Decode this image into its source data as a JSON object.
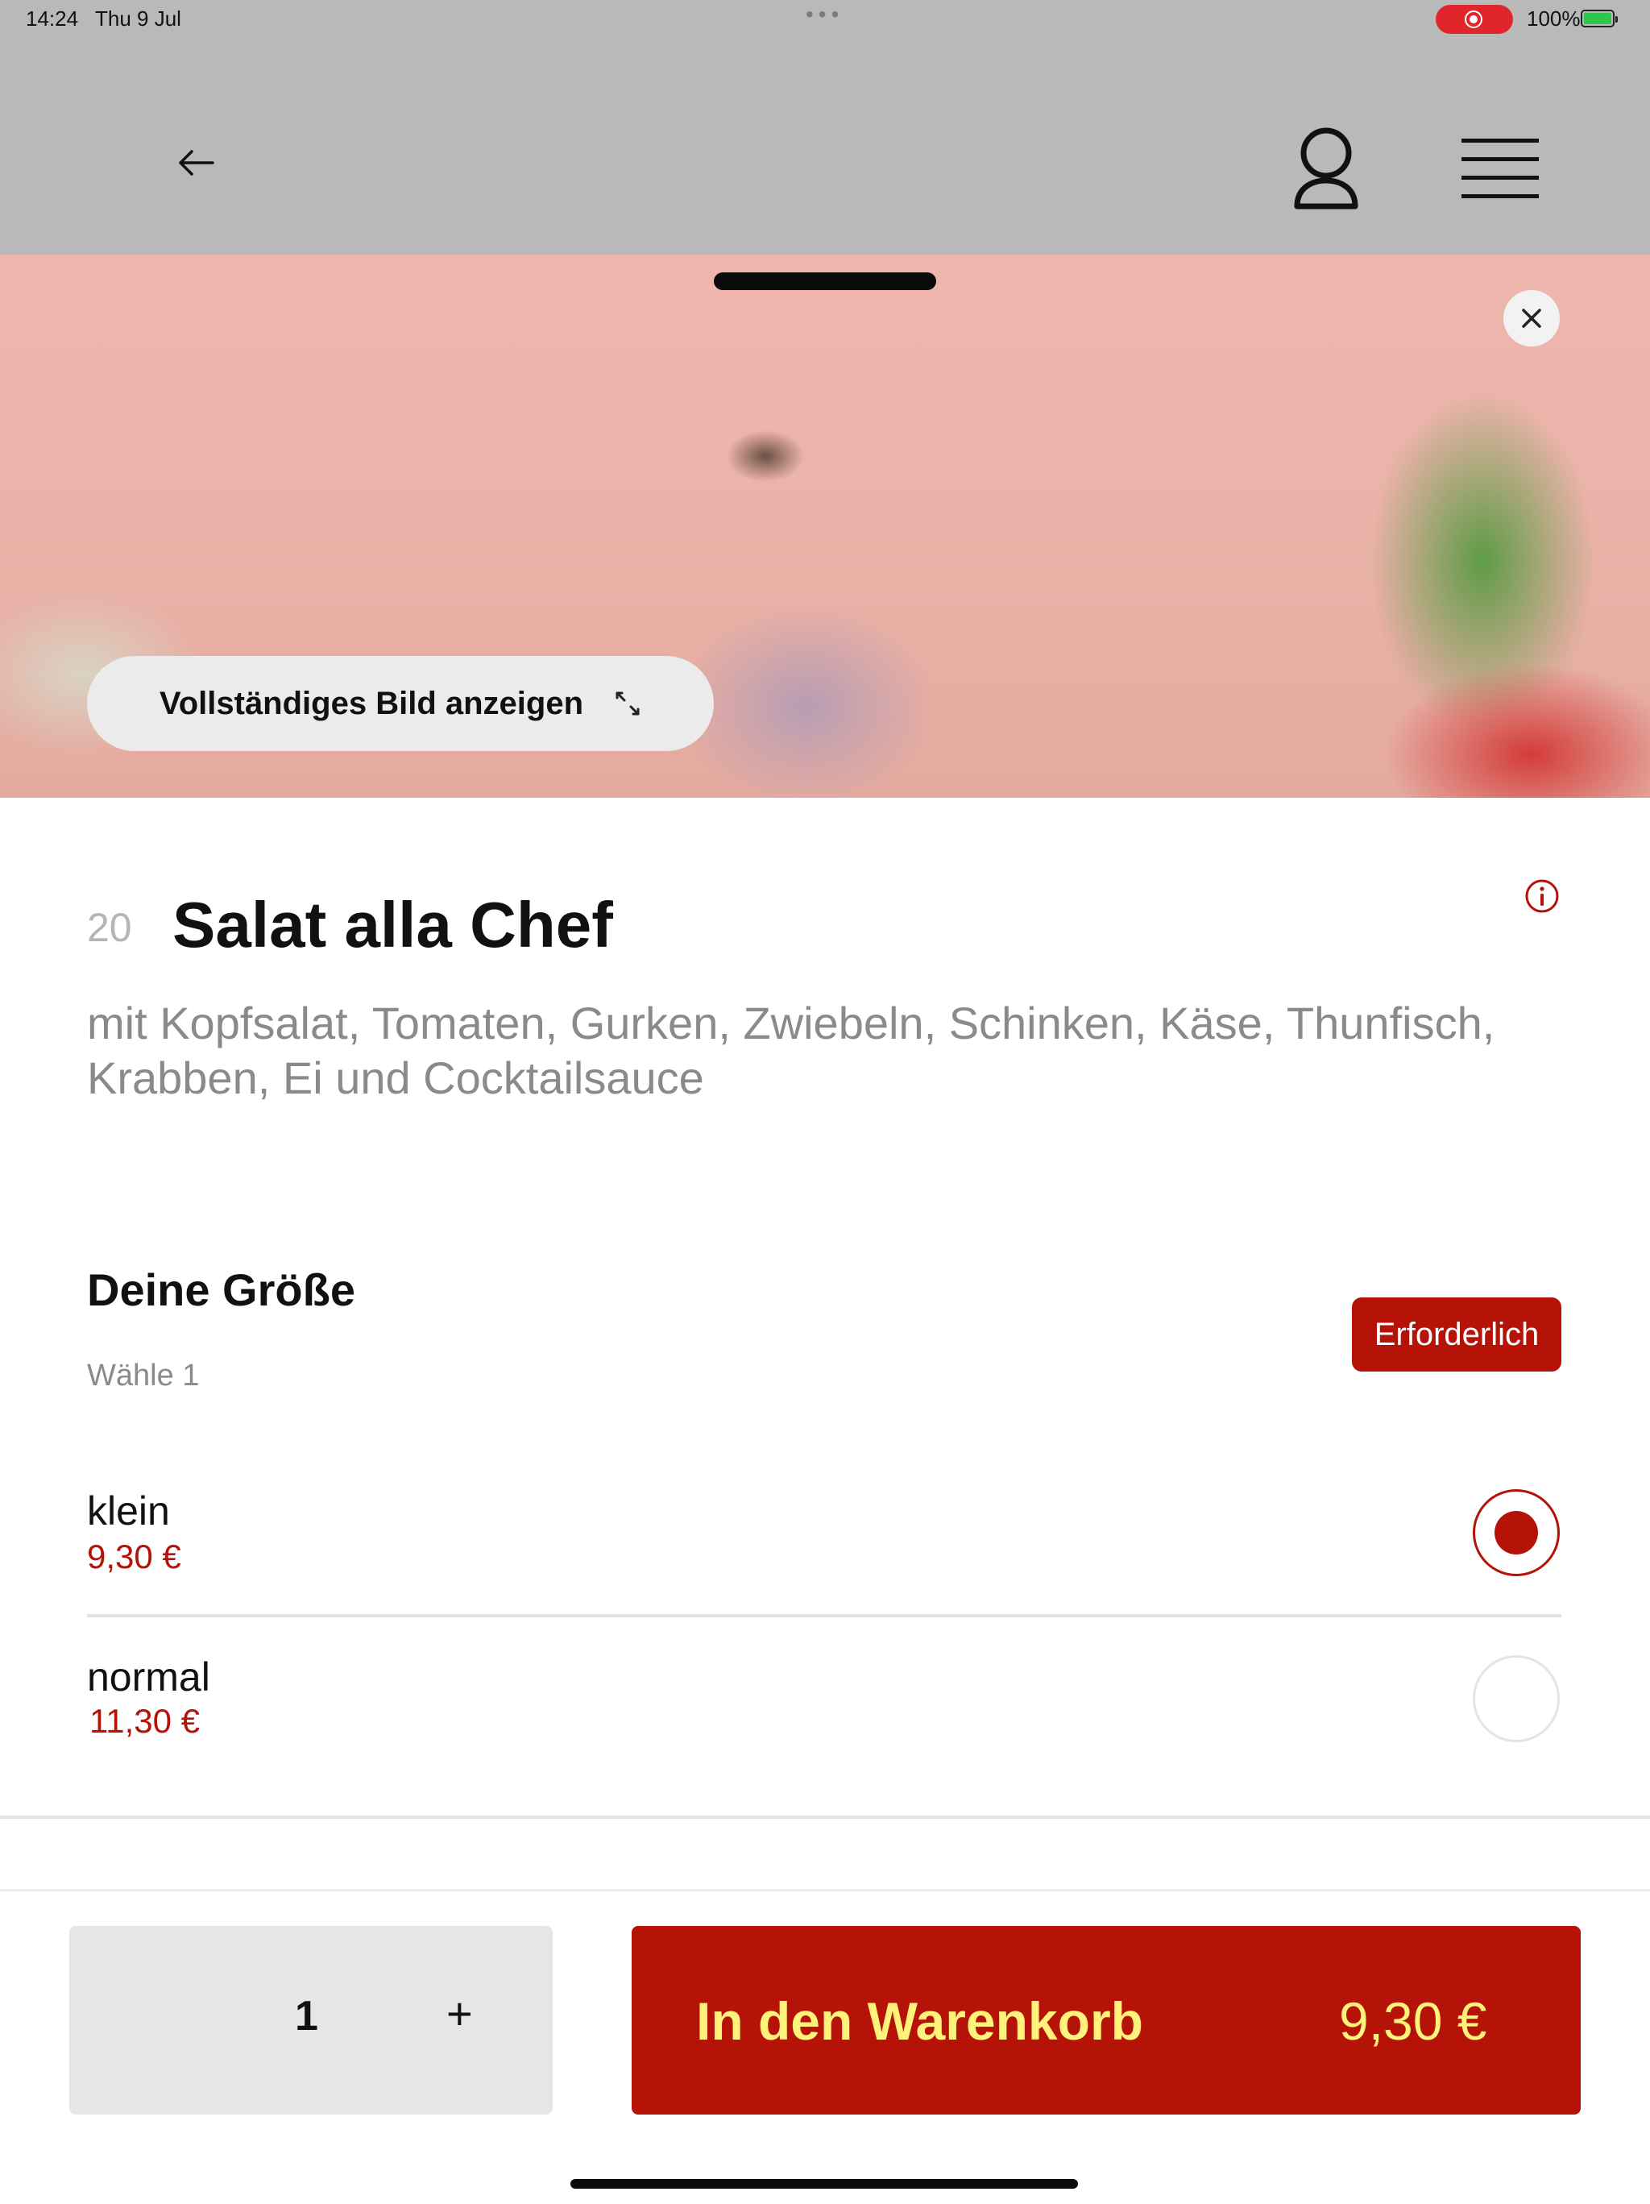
{
  "status_bar": {
    "time": "14:24",
    "date": "Thu 9 Jul",
    "dots": "•••",
    "battery": "100%"
  },
  "nav": {
    "back_icon": "arrow-left-icon",
    "user_icon": "user-icon",
    "menu_icon": "hamburger-menu-icon"
  },
  "hero": {
    "view_full_label": "Vollständiges Bild anzeigen",
    "close_icon": "close-icon",
    "expand_icon": "expand-icon"
  },
  "item": {
    "number": "20",
    "title": "Salat alla Chef",
    "description": "mit Kopfsalat, Tomaten, Gurken, Zwiebeln, Schinken, Käse, Thunfisch, Krabben, Ei und Cocktailsauce",
    "info_icon": "info-icon"
  },
  "size_section": {
    "title": "Deine Größe",
    "subtitle": "Wähle 1",
    "required_label": "Erforderlich",
    "options": [
      {
        "name": "klein",
        "price": "9,30 €",
        "selected": true
      },
      {
        "name": "normal",
        "price": "11,30 €",
        "selected": false
      }
    ]
  },
  "footer": {
    "quantity": "1",
    "plus": "+",
    "add_to_cart_label": "In den Warenkorb",
    "total_price": "9,30 €"
  },
  "colors": {
    "accent": "#b51208",
    "button_text": "#fff27a",
    "header_bg": "#b9b9b9"
  }
}
